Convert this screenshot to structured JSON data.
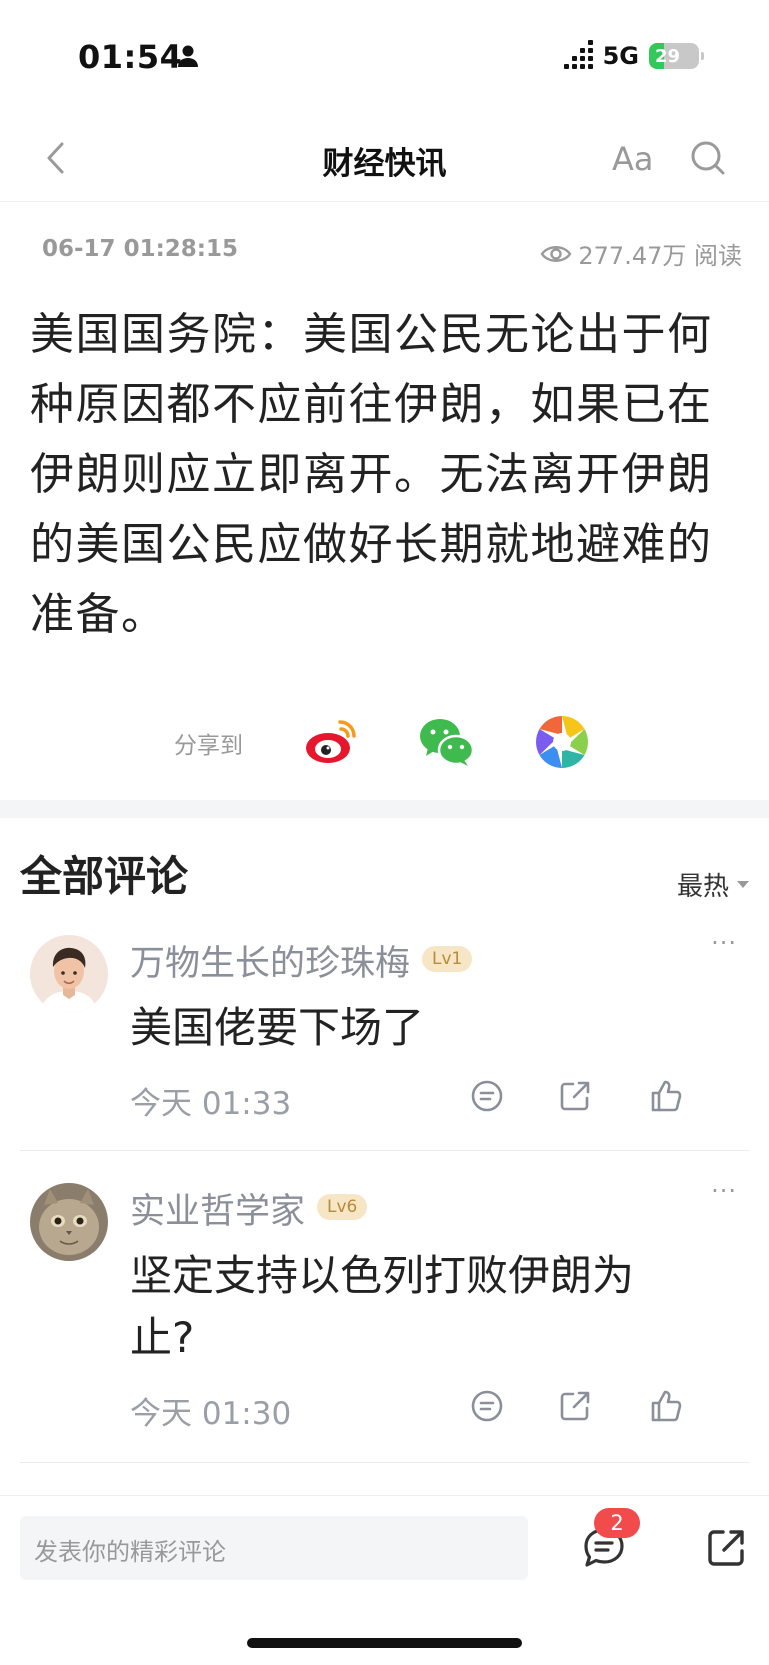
{
  "status": {
    "time": "01:54",
    "network": "5G",
    "battery": "29",
    "battery_level": 0.29
  },
  "nav": {
    "title": "财经快讯",
    "font_button": "Aa"
  },
  "meta": {
    "datetime": "06-17 01:28:15",
    "views": "277.47万 阅读"
  },
  "article": {
    "text": "美国国务院：美国公民无论出于何种原因都不应前往伊朗，如果已在伊朗则应立即离开。无法离开伊朗的美国公民应做好长期就地避难的准备。"
  },
  "share": {
    "label": "分享到",
    "targets": [
      "weibo-icon",
      "wechat-icon",
      "moments-icon"
    ]
  },
  "comments": {
    "heading": "全部评论",
    "sort": "最热",
    "more": "···",
    "items": [
      {
        "name": "万物生长的珍珠梅",
        "level": "Lv1",
        "text": "美国佬要下场了",
        "time": "今天 01:33"
      },
      {
        "name": "实业哲学家",
        "level": "Lv6",
        "text": "坚定支持以色列打败伊朗为止?",
        "time": "今天 01:30"
      }
    ]
  },
  "bottom": {
    "placeholder": "发表你的精彩评论",
    "comment_count": "2"
  },
  "colors": {
    "badge": "#f14b4b",
    "muted": "#999999",
    "level_bg": "#f6e6c6"
  }
}
